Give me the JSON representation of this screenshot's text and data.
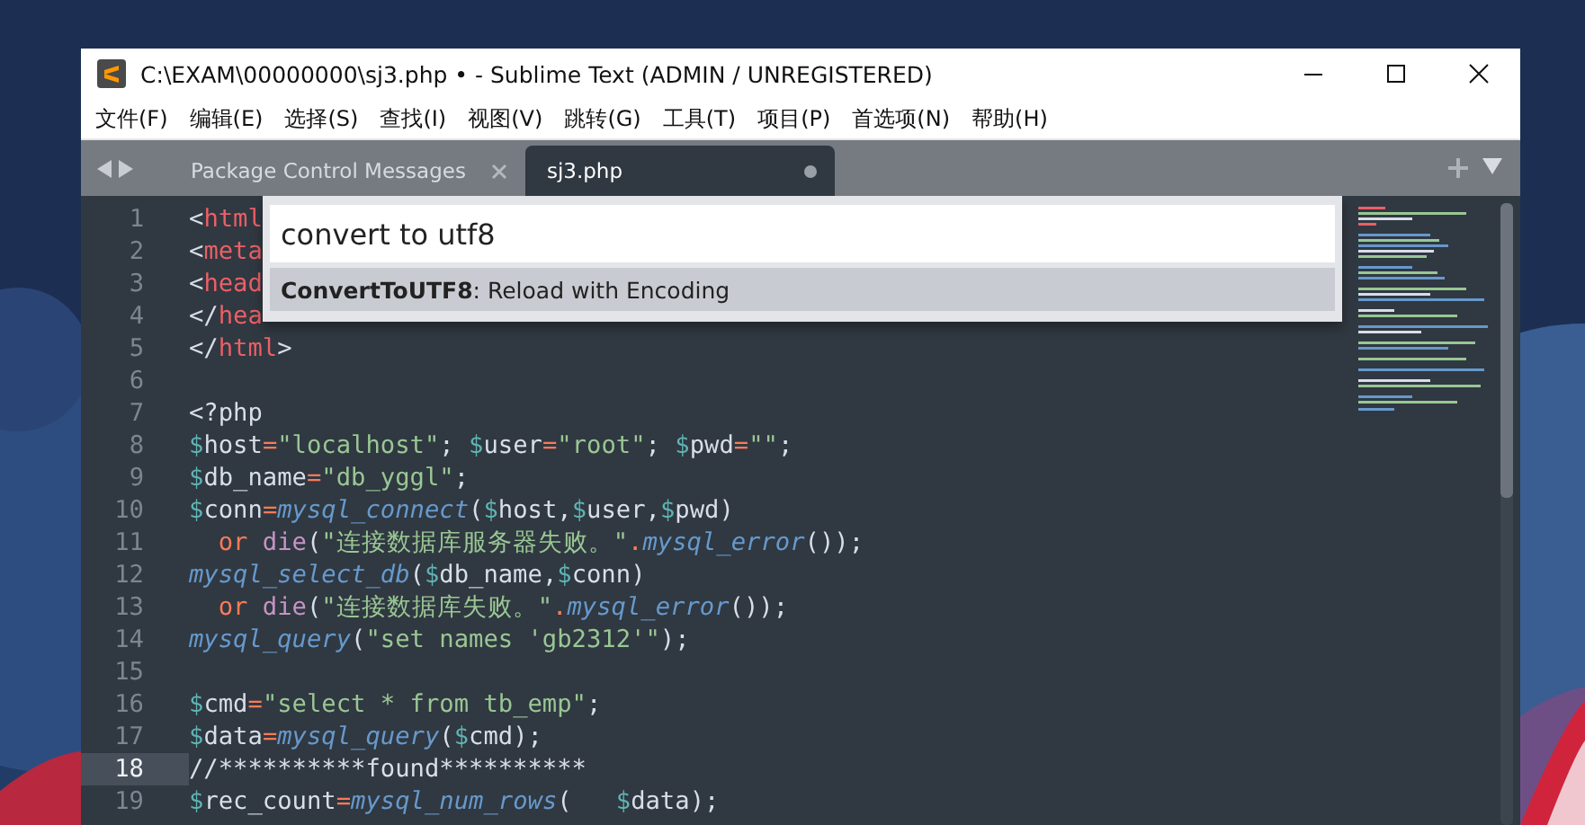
{
  "window": {
    "title": "C:\\EXAM\\00000000\\sj3.php • - Sublime Text (ADMIN / UNREGISTERED)"
  },
  "menu": [
    "文件(F)",
    "编辑(E)",
    "选择(S)",
    "查找(I)",
    "视图(V)",
    "跳转(G)",
    "工具(T)",
    "项目(P)",
    "首选项(N)",
    "帮助(H)"
  ],
  "tabs": [
    {
      "label": "Package Control Messages",
      "selected": false,
      "modified": false
    },
    {
      "label": "sj3.php",
      "selected": true,
      "modified": true
    }
  ],
  "editor": {
    "lines": [
      {
        "number": "1",
        "current": false,
        "tokens": [
          {
            "kind": "punc",
            "text": "<"
          },
          {
            "kind": "tag",
            "text": "html"
          }
        ]
      },
      {
        "number": "2",
        "current": false,
        "tokens": [
          {
            "kind": "punc",
            "text": "<"
          },
          {
            "kind": "tag",
            "text": "meta"
          }
        ]
      },
      {
        "number": "3",
        "current": false,
        "tokens": [
          {
            "kind": "punc",
            "text": "<"
          },
          {
            "kind": "tag",
            "text": "head"
          }
        ]
      },
      {
        "number": "4",
        "current": false,
        "tokens": [
          {
            "kind": "punc",
            "text": "</"
          },
          {
            "kind": "tag",
            "text": "hea"
          }
        ]
      },
      {
        "number": "5",
        "current": false,
        "tokens": [
          {
            "kind": "punc",
            "text": "</"
          },
          {
            "kind": "tag",
            "text": "html"
          },
          {
            "kind": "punc",
            "text": ">"
          }
        ]
      },
      {
        "number": "6",
        "current": false
      },
      {
        "number": "7",
        "current": false,
        "tokens": [
          {
            "kind": "punc",
            "text": "<?php"
          }
        ]
      },
      {
        "number": "8",
        "current": false,
        "tokens": [
          {
            "kind": "dollar",
            "text": "$"
          },
          {
            "kind": "var",
            "text": "host"
          },
          {
            "kind": "op",
            "text": "="
          },
          {
            "kind": "str",
            "text": "\"localhost\""
          },
          {
            "kind": "punc",
            "text": "; "
          },
          {
            "kind": "dollar",
            "text": "$"
          },
          {
            "kind": "var",
            "text": "user"
          },
          {
            "kind": "op",
            "text": "="
          },
          {
            "kind": "str",
            "text": "\"root\""
          },
          {
            "kind": "punc",
            "text": "; "
          },
          {
            "kind": "dollar",
            "text": "$"
          },
          {
            "kind": "var",
            "text": "pwd"
          },
          {
            "kind": "op",
            "text": "="
          },
          {
            "kind": "str",
            "text": "\"\""
          },
          {
            "kind": "punc",
            "text": ";"
          }
        ]
      },
      {
        "number": "9",
        "current": false,
        "tokens": [
          {
            "kind": "dollar",
            "text": "$"
          },
          {
            "kind": "var",
            "text": "db_name"
          },
          {
            "kind": "op",
            "text": "="
          },
          {
            "kind": "str",
            "text": "\"db_yggl\""
          },
          {
            "kind": "punc",
            "text": ";"
          }
        ]
      },
      {
        "number": "10",
        "current": false,
        "tokens": [
          {
            "kind": "dollar",
            "text": "$"
          },
          {
            "kind": "var",
            "text": "conn"
          },
          {
            "kind": "op",
            "text": "="
          },
          {
            "kind": "func",
            "text": "mysql_connect"
          },
          {
            "kind": "punc",
            "text": "("
          },
          {
            "kind": "dollar",
            "text": "$"
          },
          {
            "kind": "var",
            "text": "host"
          },
          {
            "kind": "punc",
            "text": ","
          },
          {
            "kind": "dollar",
            "text": "$"
          },
          {
            "kind": "var",
            "text": "user"
          },
          {
            "kind": "punc",
            "text": ","
          },
          {
            "kind": "dollar",
            "text": "$"
          },
          {
            "kind": "var",
            "text": "pwd"
          },
          {
            "kind": "punc",
            "text": ")"
          }
        ]
      },
      {
        "number": "11",
        "current": false,
        "indented": true,
        "tokens": [
          {
            "kind": "kw",
            "text": "or "
          },
          {
            "kind": "builtin",
            "text": "die"
          },
          {
            "kind": "punc",
            "text": "("
          },
          {
            "kind": "str",
            "text": "\"连接数据库服务器失败。\""
          },
          {
            "kind": "op",
            "text": "."
          },
          {
            "kind": "func",
            "text": "mysql_error"
          },
          {
            "kind": "punc",
            "text": "());"
          }
        ]
      },
      {
        "number": "12",
        "current": false,
        "tokens": [
          {
            "kind": "func",
            "text": "mysql_select_db"
          },
          {
            "kind": "punc",
            "text": "("
          },
          {
            "kind": "dollar",
            "text": "$"
          },
          {
            "kind": "var",
            "text": "db_name"
          },
          {
            "kind": "punc",
            "text": ","
          },
          {
            "kind": "dollar",
            "text": "$"
          },
          {
            "kind": "var",
            "text": "conn"
          },
          {
            "kind": "punc",
            "text": ")"
          }
        ]
      },
      {
        "number": "13",
        "current": false,
        "indented": true,
        "tokens": [
          {
            "kind": "kw",
            "text": "or "
          },
          {
            "kind": "builtin",
            "text": "die"
          },
          {
            "kind": "punc",
            "text": "("
          },
          {
            "kind": "str",
            "text": "\"连接数据库失败。\""
          },
          {
            "kind": "op",
            "text": "."
          },
          {
            "kind": "func",
            "text": "mysql_error"
          },
          {
            "kind": "punc",
            "text": "());"
          }
        ]
      },
      {
        "number": "14",
        "current": false,
        "tokens": [
          {
            "kind": "func",
            "text": "mysql_query"
          },
          {
            "kind": "punc",
            "text": "("
          },
          {
            "kind": "str",
            "text": "\"set names 'gb2312'\""
          },
          {
            "kind": "punc",
            "text": ");"
          }
        ]
      },
      {
        "number": "15",
        "current": false
      },
      {
        "number": "16",
        "current": false,
        "tokens": [
          {
            "kind": "dollar",
            "text": "$"
          },
          {
            "kind": "var",
            "text": "cmd"
          },
          {
            "kind": "op",
            "text": "="
          },
          {
            "kind": "str",
            "text": "\"select * from tb_emp\""
          },
          {
            "kind": "punc",
            "text": ";"
          }
        ]
      },
      {
        "number": "17",
        "current": false,
        "tokens": [
          {
            "kind": "dollar",
            "text": "$"
          },
          {
            "kind": "var",
            "text": "data"
          },
          {
            "kind": "op",
            "text": "="
          },
          {
            "kind": "func",
            "text": "mysql_query"
          },
          {
            "kind": "punc",
            "text": "("
          },
          {
            "kind": "dollar",
            "text": "$"
          },
          {
            "kind": "var",
            "text": "cmd"
          },
          {
            "kind": "punc",
            "text": ");"
          }
        ]
      },
      {
        "number": "18",
        "current": true,
        "tokens": [
          {
            "kind": "comment",
            "text": "//**********found**********"
          }
        ]
      },
      {
        "number": "19",
        "current": false,
        "tokens": [
          {
            "kind": "dollar",
            "text": "$"
          },
          {
            "kind": "var",
            "text": "rec_count"
          },
          {
            "kind": "op",
            "text": "="
          },
          {
            "kind": "func",
            "text": "mysql_num_rows"
          },
          {
            "kind": "punc",
            "text": "(   "
          },
          {
            "kind": "dollar",
            "text": "$"
          },
          {
            "kind": "var",
            "text": "data"
          },
          {
            "kind": "punc",
            "text": ");"
          }
        ]
      }
    ]
  },
  "command_palette": {
    "value": "convert to utf8",
    "results": [
      {
        "text": "**ConvertToUTF8**: Reload with Encoding",
        "selected": true
      }
    ]
  }
}
